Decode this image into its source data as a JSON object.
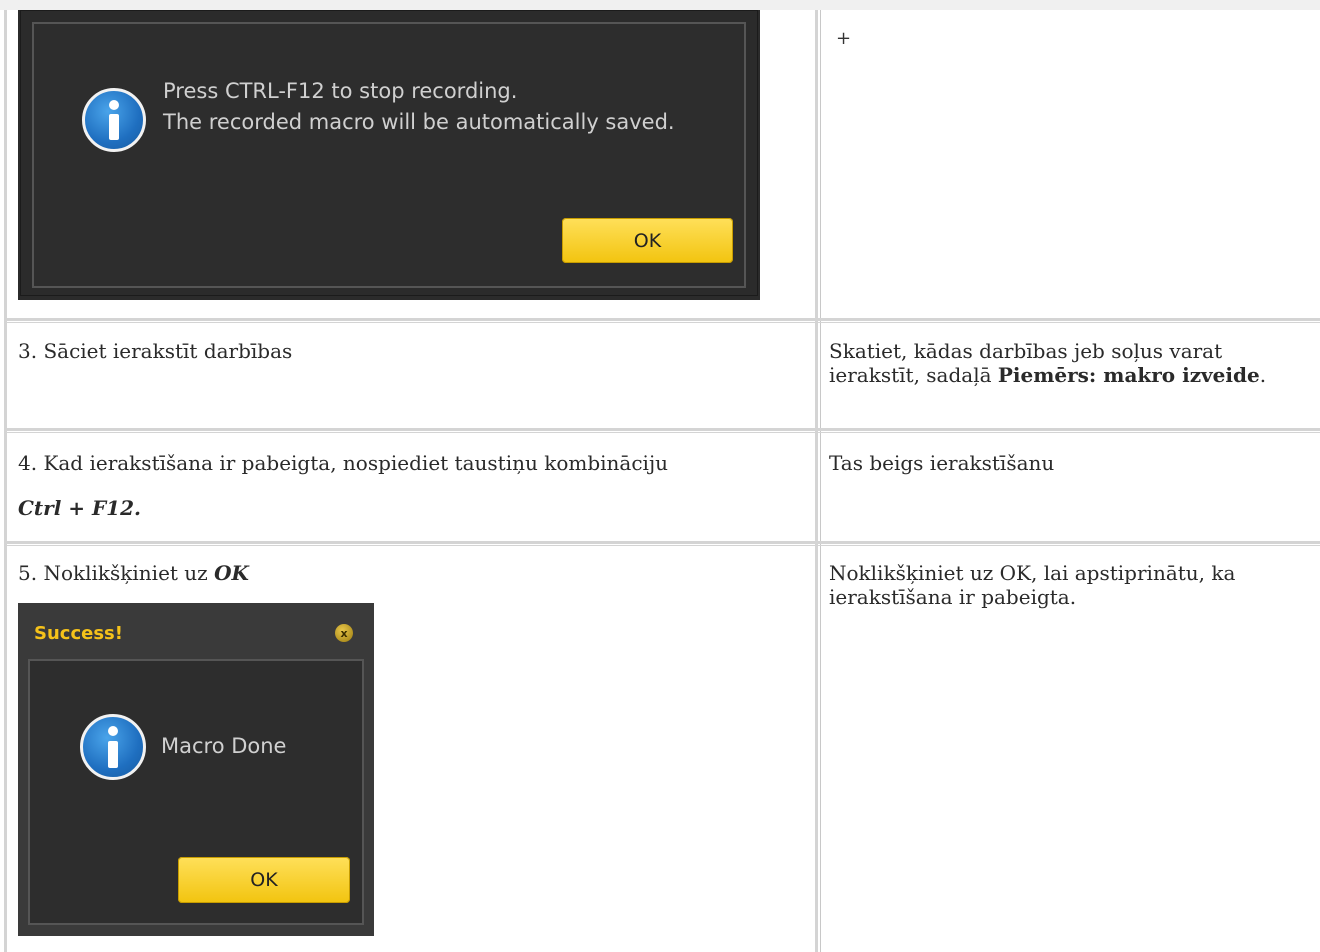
{
  "dialog_recording": {
    "message_line1": "Press CTRL-F12 to stop recording.",
    "message_line2": "The recorded macro will be automatically saved.",
    "ok_label": "OK"
  },
  "rows": [
    {
      "plus": "+"
    },
    {
      "step": "3. Sāciet ierakstīt darbības",
      "desc_prefix": "Skatiet, kādas darbības jeb soļus varat ierakstīt, sadaļā ",
      "desc_bold": "Piemērs: makro izveide",
      "desc_suffix": "."
    },
    {
      "step_text": "4. Kad ierakstīšana ir pabeigta, nospiediet taustiņu kombināciju",
      "step_keys": "Ctrl + F12.",
      "desc": "Tas beigs ierakstīšanu"
    },
    {
      "step_prefix": "5. Noklikšķiniet uz ",
      "step_bold": "OK",
      "desc": "Noklikšķiniet uz OK, lai apstiprinātu, ka ierakstīšana ir pabeigta."
    }
  ],
  "dialog_success": {
    "title": "Success!",
    "close_symbol": "x",
    "message": "Macro Done",
    "ok_label": "OK"
  }
}
